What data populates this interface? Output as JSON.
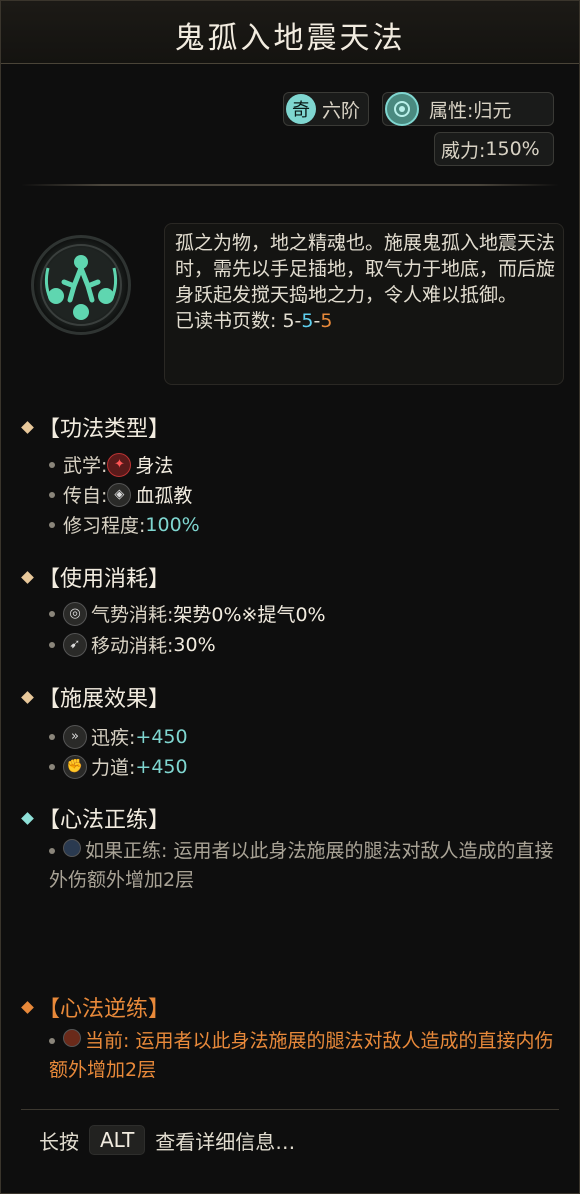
{
  "title": "鬼孤入地震天法",
  "tier": {
    "icon_char": "奇",
    "label": "六阶"
  },
  "attribute": {
    "label": "属性: ",
    "value": "归元"
  },
  "power": {
    "label": "威力: ",
    "value": "150%"
  },
  "description": "孤之为物，地之精魂也。施展鬼孤入地震天法时，需先以手足插地，取气力于地底，而后旋身跃起发搅天捣地之力，令人难以抵御。",
  "pages_read": {
    "label": "已读书页数: ",
    "v1": "5",
    "sep1": "-",
    "v2": "5",
    "sep2": "-",
    "v3": "5"
  },
  "sections": {
    "type": {
      "header": "【功法类型】",
      "rows": [
        {
          "label": "武学: ",
          "value": "身法",
          "icon": "shenfa-icon"
        },
        {
          "label": "传自: ",
          "value": "血孤教",
          "icon": "wolf-icon"
        },
        {
          "label": "修习程度: ",
          "value": "100%"
        }
      ]
    },
    "cost": {
      "header": "【使用消耗】",
      "rows": [
        {
          "label": "气势消耗: ",
          "value": "架势0%※提气0%",
          "icon": "qi-icon"
        },
        {
          "label": "移动消耗: ",
          "value": "30%",
          "icon": "move-icon"
        }
      ]
    },
    "effect": {
      "header": "【施展效果】",
      "rows": [
        {
          "label": "迅疾: ",
          "value": "+450",
          "icon": "speed-icon"
        },
        {
          "label": "力道: ",
          "value": "+450",
          "icon": "fist-icon"
        }
      ]
    },
    "zheng": {
      "header": "【心法正练】",
      "text": "如果正练: 运用者以此身法施展的腿法对敌人造成的直接外伤额外增加2层"
    },
    "ni": {
      "header": "【心法逆练】",
      "text": "当前: 运用者以此身法施展的腿法对敌人造成的直接内伤额外增加2层"
    }
  },
  "footer": {
    "prefix": "长按",
    "key": "ALT",
    "suffix": "查看详细信息…"
  },
  "colors": {
    "teal": "#7fd6d0",
    "orange": "#e8893a",
    "cream": "#f2ece0",
    "gold_diamond": "#e8c89a",
    "teal_diamond": "#8fe0d8",
    "orange_diamond": "#e8893a"
  }
}
